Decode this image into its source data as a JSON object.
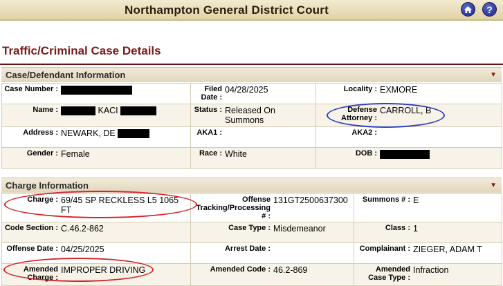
{
  "header": {
    "court_name": "Northampton General District Court",
    "home_icon": "home-icon",
    "help_icon": "help-icon",
    "help_glyph": "?"
  },
  "page_title": "Traffic/Criminal Case Details",
  "case_section": {
    "title": "Case/Defendant Information",
    "toggle_icon": "collapse-triangle-icon",
    "case_number_label": "Case Number :",
    "filed_label": "Filed Date :",
    "filed_value": "04/28/2025",
    "locality_label": "Locality :",
    "locality_value": "EXMORE",
    "name_label": "Name :",
    "name_value": "KACI",
    "status_label": "Status :",
    "status_value": "Released On Summons",
    "defense_label": "Defense Attorney :",
    "defense_value": "CARROLL, B",
    "address_label": "Address :",
    "address_value": "NEWARK, DE",
    "aka1_label": "AKA1 :",
    "aka2_label": "AKA2 :",
    "gender_label": "Gender :",
    "gender_value": "Female",
    "race_label": "Race :",
    "race_value": "White",
    "dob_label": "DOB :"
  },
  "charge_section": {
    "title": "Charge Information",
    "toggle_icon": "collapse-triangle-icon",
    "charge_label": "Charge :",
    "charge_value": "69/45 SP RECKLESS L5 1065 FT",
    "offense_track_label": "Offense Tracking/Processing # :",
    "offense_track_value": "131GT2500637300",
    "summons_label": "Summons # :",
    "summons_value": "E",
    "code_section_label": "Code Section :",
    "code_section_value": "C.46.2-862",
    "case_type_label": "Case Type :",
    "case_type_value": "Misdemeanor",
    "class_label": "Class :",
    "class_value": "1",
    "offense_date_label": "Offense Date :",
    "offense_date_value": "04/25/2025",
    "arrest_date_label": "Arrest Date :",
    "complainant_label": "Complainant :",
    "complainant_value": "ZIEGER, ADAM T",
    "amended_charge_label": "Amended Charge :",
    "amended_charge_value": "IMPROPER DRIVING",
    "amended_code_label": "Amended Code :",
    "amended_code_value": "46.2-869",
    "amended_case_type_label": "Amended Case Type :",
    "amended_case_type_value": "Infraction"
  },
  "colors": {
    "title_red": "#7a1c1c",
    "annotation_blue": "#2a3fbf",
    "annotation_red": "#d4232a"
  }
}
